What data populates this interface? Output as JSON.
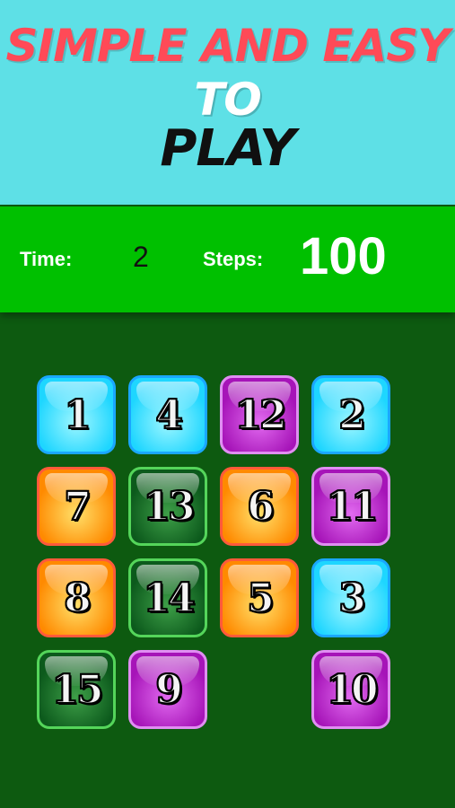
{
  "banner": {
    "line1": "SIMPLE AND EASY",
    "line2": "TO",
    "line3": "PLAY"
  },
  "status": {
    "time_label": "Time:",
    "time_value": "2",
    "steps_label": "Steps:",
    "steps_value": "100"
  },
  "board": {
    "rows": 4,
    "cols": 4,
    "tiles": [
      {
        "number": "1",
        "color": "cyan"
      },
      {
        "number": "4",
        "color": "cyan"
      },
      {
        "number": "12",
        "color": "purple"
      },
      {
        "number": "2",
        "color": "cyan"
      },
      {
        "number": "7",
        "color": "orange"
      },
      {
        "number": "13",
        "color": "green"
      },
      {
        "number": "6",
        "color": "orange"
      },
      {
        "number": "11",
        "color": "purple"
      },
      {
        "number": "8",
        "color": "orange"
      },
      {
        "number": "14",
        "color": "green"
      },
      {
        "number": "5",
        "color": "orange"
      },
      {
        "number": "3",
        "color": "cyan"
      },
      {
        "number": "15",
        "color": "green"
      },
      {
        "number": "9",
        "color": "purple"
      },
      {
        "number": "",
        "color": "empty"
      },
      {
        "number": "10",
        "color": "purple"
      }
    ]
  }
}
